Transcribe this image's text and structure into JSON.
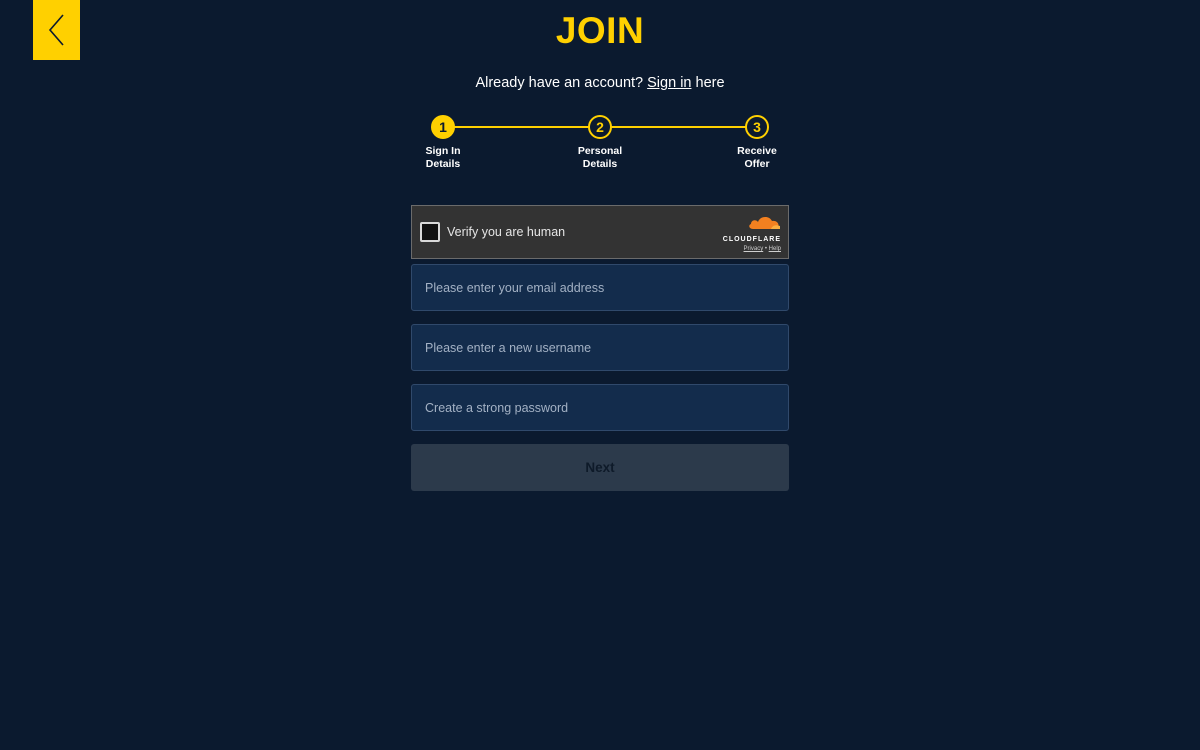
{
  "header": {
    "back_icon": "chevron-left-icon",
    "title": "JOIN"
  },
  "signin": {
    "prefix": "Already have an account?",
    "link": "Sign in",
    "suffix": "here"
  },
  "stepper": {
    "steps": [
      {
        "number": "1",
        "label_line1": "Sign In",
        "label_line2": "Details",
        "active": true
      },
      {
        "number": "2",
        "label_line1": "Personal",
        "label_line2": "Details",
        "active": false
      },
      {
        "number": "3",
        "label_line1": "Receive",
        "label_line2": "Offer",
        "active": false
      }
    ]
  },
  "captcha": {
    "label": "Verify you are human",
    "brand": "CLOUDFLARE",
    "privacy": "Privacy",
    "separator": "•",
    "help": "Help",
    "icon": "cloudflare-cloud-icon"
  },
  "form": {
    "email_placeholder": "Please enter your email address",
    "username_placeholder": "Please enter a new username",
    "password_placeholder": "Create a strong password",
    "next_label": "Next"
  },
  "colors": {
    "background": "#0b1a2f",
    "accent": "#ffd000",
    "field": "#132c4c",
    "button_disabled": "#2c3a4b",
    "cloudflare_orange": "#f38020"
  }
}
